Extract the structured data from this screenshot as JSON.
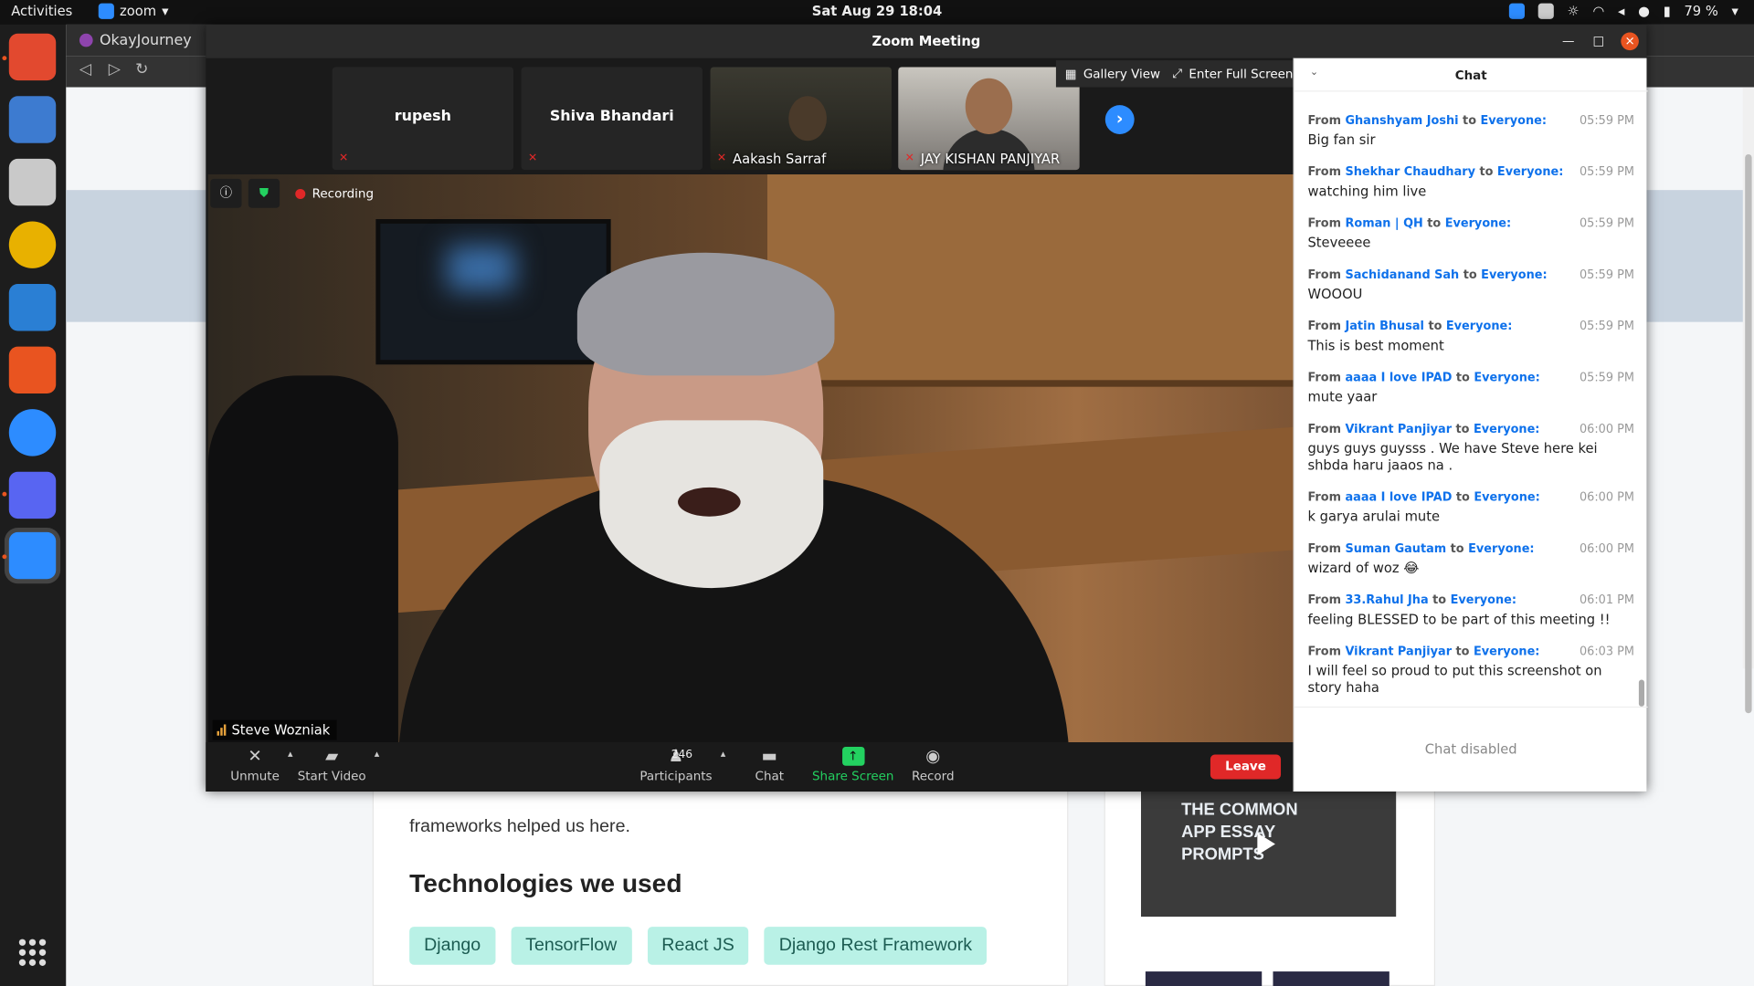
{
  "system_bar": {
    "activities": "Activities",
    "app_name": "zoom",
    "clock": "Sat Aug 29  18:04",
    "battery": "79 %"
  },
  "browser": {
    "tab_title": "OkayJourney",
    "page_text": "frameworks helped us here.",
    "section_heading": "Technologies we used",
    "tags": [
      "Django",
      "TensorFlow",
      "React JS",
      "Django Rest Framework"
    ],
    "video_title": "THE COMMON APP ESSAY PROMPTS"
  },
  "zoom": {
    "window_title": "Zoom Meeting",
    "gallery_view": "Gallery View",
    "full_screen": "Enter Full Screen",
    "participants_thumbs": [
      {
        "name": "rupesh"
      },
      {
        "name": "Shiva Bhandari"
      },
      {
        "name": "Aakash Sarraf"
      },
      {
        "name": "JAY KISHAN PANJIYAR"
      }
    ],
    "recording": "Recording",
    "active_speaker": "Steve Wozniak",
    "controls": {
      "unmute": "Unmute",
      "start_video": "Start Video",
      "participants": "Participants",
      "participant_count": "246",
      "chat": "Chat",
      "share_screen": "Share Screen",
      "record": "Record",
      "leave": "Leave"
    },
    "chat_panel": {
      "title": "Chat",
      "disabled": "Chat disabled",
      "from": "From",
      "to_word": "to",
      "audience": "Everyone:",
      "messages": [
        {
          "from": "Ghanshyam Joshi",
          "time": "05:59 PM",
          "text": "Big fan sir"
        },
        {
          "from": "Shekhar Chaudhary",
          "time": "05:59 PM",
          "text": "watching him live"
        },
        {
          "from": "Roman | QH",
          "time": "05:59 PM",
          "text": "Steveeee"
        },
        {
          "from": "Sachidanand Sah",
          "time": "05:59 PM",
          "text": "WOOOU"
        },
        {
          "from": "Jatin Bhusal",
          "time": "05:59 PM",
          "text": "This is best moment"
        },
        {
          "from": "aaaa I love IPAD",
          "time": "05:59 PM",
          "text": "mute yaar"
        },
        {
          "from": "Vikrant Panjiyar",
          "time": "06:00 PM",
          "text": "guys guys guysss . We have Steve here kei shbda haru jaaos na ."
        },
        {
          "from": "aaaa I love IPAD",
          "time": "06:00 PM",
          "text": "k garya arulai mute"
        },
        {
          "from": "Suman Gautam",
          "time": "06:00 PM",
          "text": "wizard of woz 😂"
        },
        {
          "from": "33.Rahul Jha",
          "time": "06:01 PM",
          "text": "feeling BLESSED to be part of this meeting !!"
        },
        {
          "from": "Vikrant Panjiyar",
          "time": "06:03 PM",
          "text": "I will feel so proud to put this screenshot on story haha"
        }
      ]
    }
  }
}
